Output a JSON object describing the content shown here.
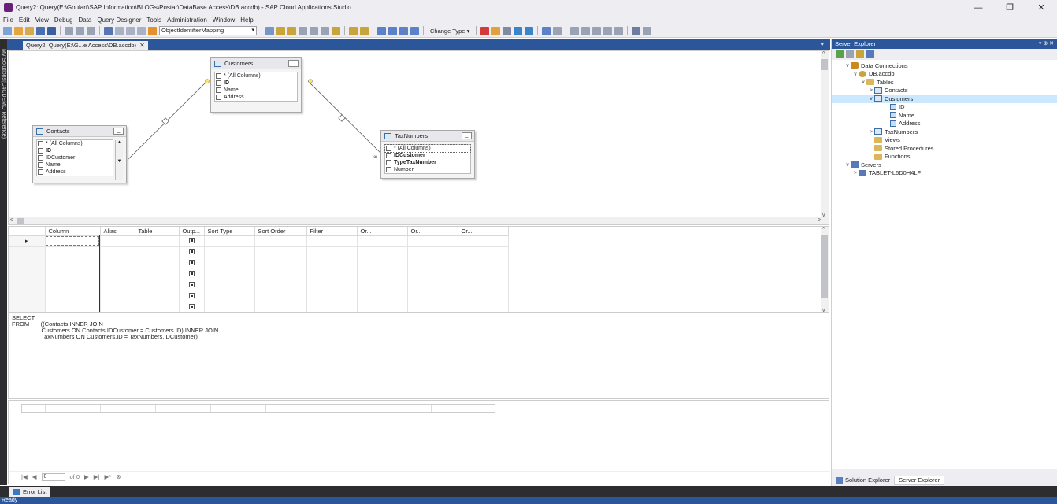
{
  "window": {
    "title": "Query2: Query(E:\\Goulart\\SAP Information\\BLOGs\\Postar\\DataBase Access\\DB.accdb) - SAP Cloud Applications Studio",
    "minimize": "—",
    "restore": "❐",
    "close": "✕"
  },
  "menu": [
    "File",
    "Edit",
    "View",
    "Debug",
    "Data",
    "Query Designer",
    "Tools",
    "Administration",
    "Window",
    "Help"
  ],
  "toolbar": {
    "combo_value": "ObjectIdentifierMapping",
    "change_type": "Change Type ▾"
  },
  "left_strip": {
    "label": "My Solutions(C4CDEMO Reference)"
  },
  "document_tab": {
    "label": "Query2: Query(E:\\G...e Access\\DB.accdb)",
    "close": "✕"
  },
  "diagram": {
    "tables": [
      {
        "name": "Customers",
        "rows": [
          {
            "label": "* (All Columns)",
            "bold": false
          },
          {
            "label": "ID",
            "bold": true
          },
          {
            "label": "Name",
            "bold": false
          },
          {
            "label": "Address",
            "bold": false
          }
        ]
      },
      {
        "name": "Contacts",
        "rows": [
          {
            "label": "* (All Columns)",
            "bold": false
          },
          {
            "label": "ID",
            "bold": true
          },
          {
            "label": "IDCustomer",
            "bold": false
          },
          {
            "label": "Name",
            "bold": false
          },
          {
            "label": "Address",
            "bold": false
          }
        ]
      },
      {
        "name": "TaxNumbers",
        "rows": [
          {
            "label": "* (All Columns)",
            "bold": false
          },
          {
            "label": "IDCustomer",
            "bold": true
          },
          {
            "label": "TypeTaxNumber",
            "bold": true
          },
          {
            "label": "Number",
            "bold": false
          }
        ]
      }
    ]
  },
  "criteria_grid": {
    "columns": [
      "Column",
      "Alias",
      "Table",
      "Outp...",
      "Sort Type",
      "Sort Order",
      "Filter",
      "Or...",
      "Or...",
      "Or..."
    ],
    "row_count": 7
  },
  "sql": {
    "lines": [
      "SELECT",
      "FROM       ((Contacts INNER JOIN",
      "                  Customers ON Contacts.IDCustomer = Customers.ID) INNER JOIN",
      "                  TaxNumbers ON Customers.ID = TaxNumbers.IDCustomer)"
    ]
  },
  "results_nav": {
    "first": "|◀",
    "prev": "◀",
    "page_value": "0",
    "of_label": "of 0",
    "next": "▶",
    "last": "▶|",
    "new": "▶*",
    "stop": "⊗"
  },
  "error_list": {
    "label": "Error List"
  },
  "status": {
    "text": "Ready"
  },
  "server_explorer": {
    "title": "Server Explorer",
    "header_buttons": "▾ ⊕ ✕",
    "tree": [
      {
        "label": "Data Connections",
        "arrow": "∨",
        "icon": "ic-conn",
        "level": 0
      },
      {
        "label": "DB.accdb",
        "arrow": "∨",
        "icon": "ic-db",
        "level": 1
      },
      {
        "label": "Tables",
        "arrow": "∨",
        "icon": "ic-folder",
        "level": 2
      },
      {
        "label": "Contacts",
        "arrow": ">",
        "icon": "ic-table",
        "level": 3
      },
      {
        "label": "Customers",
        "arrow": "∨",
        "icon": "ic-table",
        "level": 3,
        "selected": true
      },
      {
        "label": "ID",
        "arrow": "",
        "icon": "ic-col",
        "level": 4
      },
      {
        "label": "Name",
        "arrow": "",
        "icon": "ic-col",
        "level": 4
      },
      {
        "label": "Address",
        "arrow": "",
        "icon": "ic-col",
        "level": 4
      },
      {
        "label": "TaxNumbers",
        "arrow": ">",
        "icon": "ic-table",
        "level": 3
      },
      {
        "label": "Views",
        "arrow": "",
        "icon": "ic-folder",
        "level": 3
      },
      {
        "label": "Stored Procedures",
        "arrow": "",
        "icon": "ic-folder",
        "level": 3
      },
      {
        "label": "Functions",
        "arrow": "",
        "icon": "ic-folder",
        "level": 3
      },
      {
        "label": "Servers",
        "arrow": "∨",
        "icon": "ic-server",
        "level": 0
      },
      {
        "label": "TABLET-L6D0H4LF",
        "arrow": ">",
        "icon": "ic-server",
        "level": 1
      }
    ],
    "bottom_tabs": [
      "Solution Explorer",
      "Server Explorer"
    ]
  },
  "colors": {
    "accent": "#2b579a",
    "chrome": "#eeeef2",
    "dark_strip": "#2d2d30"
  }
}
